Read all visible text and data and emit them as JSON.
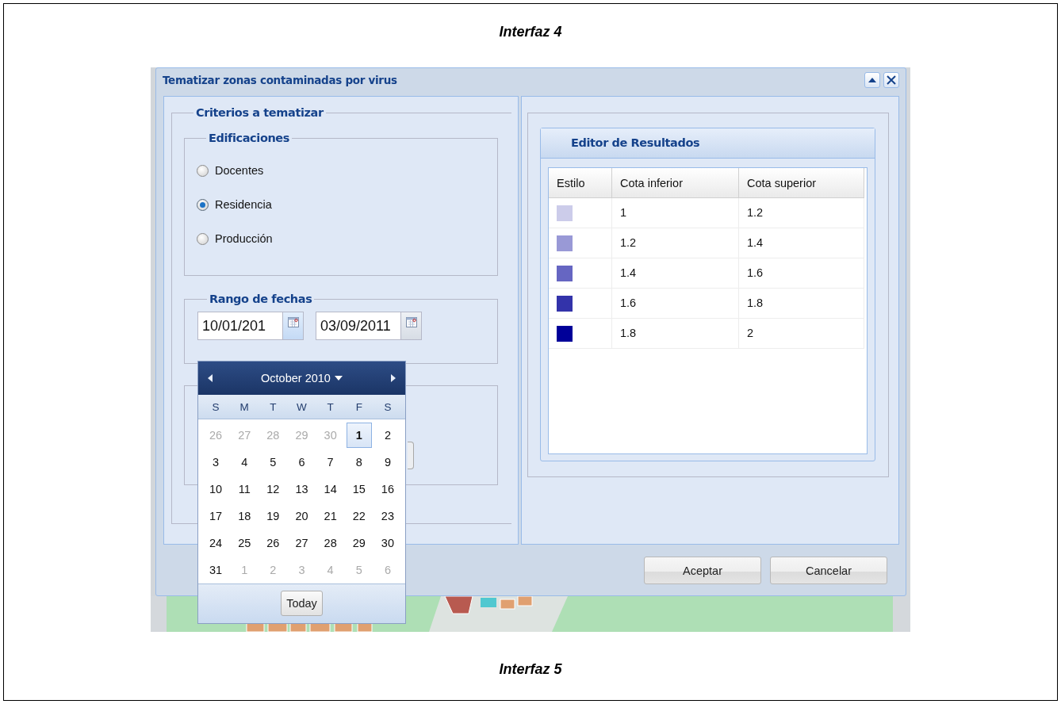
{
  "document": {
    "caption_top": "Interfaz 4",
    "caption_bottom": "Interfaz 5"
  },
  "window": {
    "title": "Tematizar zonas contaminadas por virus"
  },
  "criteria": {
    "legend": "Criterios a tematizar",
    "buildings": {
      "legend": "Edificaciones",
      "options": [
        {
          "label": "Docentes",
          "selected": false
        },
        {
          "label": "Residencia",
          "selected": true
        },
        {
          "label": "Producción",
          "selected": false
        }
      ]
    },
    "date_range": {
      "legend": "Rango de fechas",
      "from": "10/01/201",
      "to": "03/09/2011"
    }
  },
  "calendar": {
    "month_label": "October 2010",
    "weekdays": [
      "S",
      "M",
      "T",
      "W",
      "T",
      "F",
      "S"
    ],
    "weeks": [
      [
        {
          "day": "26",
          "muted": true,
          "selected": false
        },
        {
          "day": "27",
          "muted": true,
          "selected": false
        },
        {
          "day": "28",
          "muted": true,
          "selected": false
        },
        {
          "day": "29",
          "muted": true,
          "selected": false
        },
        {
          "day": "30",
          "muted": true,
          "selected": false
        },
        {
          "day": "1",
          "muted": false,
          "selected": true
        },
        {
          "day": "2",
          "muted": false,
          "selected": false
        }
      ],
      [
        {
          "day": "3",
          "muted": false,
          "selected": false
        },
        {
          "day": "4",
          "muted": false,
          "selected": false
        },
        {
          "day": "5",
          "muted": false,
          "selected": false
        },
        {
          "day": "6",
          "muted": false,
          "selected": false
        },
        {
          "day": "7",
          "muted": false,
          "selected": false
        },
        {
          "day": "8",
          "muted": false,
          "selected": false
        },
        {
          "day": "9",
          "muted": false,
          "selected": false
        }
      ],
      [
        {
          "day": "10",
          "muted": false,
          "selected": false
        },
        {
          "day": "11",
          "muted": false,
          "selected": false
        },
        {
          "day": "12",
          "muted": false,
          "selected": false
        },
        {
          "day": "13",
          "muted": false,
          "selected": false
        },
        {
          "day": "14",
          "muted": false,
          "selected": false
        },
        {
          "day": "15",
          "muted": false,
          "selected": false
        },
        {
          "day": "16",
          "muted": false,
          "selected": false
        }
      ],
      [
        {
          "day": "17",
          "muted": false,
          "selected": false
        },
        {
          "day": "18",
          "muted": false,
          "selected": false
        },
        {
          "day": "19",
          "muted": false,
          "selected": false
        },
        {
          "day": "20",
          "muted": false,
          "selected": false
        },
        {
          "day": "21",
          "muted": false,
          "selected": false
        },
        {
          "day": "22",
          "muted": false,
          "selected": false
        },
        {
          "day": "23",
          "muted": false,
          "selected": false
        }
      ],
      [
        {
          "day": "24",
          "muted": false,
          "selected": false
        },
        {
          "day": "25",
          "muted": false,
          "selected": false
        },
        {
          "day": "26",
          "muted": false,
          "selected": false
        },
        {
          "day": "27",
          "muted": false,
          "selected": false
        },
        {
          "day": "28",
          "muted": false,
          "selected": false
        },
        {
          "day": "29",
          "muted": false,
          "selected": false
        },
        {
          "day": "30",
          "muted": false,
          "selected": false
        }
      ],
      [
        {
          "day": "31",
          "muted": false,
          "selected": false
        },
        {
          "day": "1",
          "muted": true,
          "selected": false
        },
        {
          "day": "2",
          "muted": true,
          "selected": false
        },
        {
          "day": "3",
          "muted": true,
          "selected": false
        },
        {
          "day": "4",
          "muted": true,
          "selected": false
        },
        {
          "day": "5",
          "muted": true,
          "selected": false
        },
        {
          "day": "6",
          "muted": true,
          "selected": false
        }
      ]
    ],
    "today_button": "Today"
  },
  "results": {
    "title": "Editor de Resultados",
    "columns": [
      "Estilo",
      "Cota inferior",
      "Cota superior"
    ],
    "rows": [
      {
        "color": "#ccccea",
        "lower": "1",
        "upper": "1.2"
      },
      {
        "color": "#9999d6",
        "lower": "1.2",
        "upper": "1.4"
      },
      {
        "color": "#6666c2",
        "lower": "1.4",
        "upper": "1.6"
      },
      {
        "color": "#3333aa",
        "lower": "1.6",
        "upper": "1.8"
      },
      {
        "color": "#000099",
        "lower": "1.8",
        "upper": "2"
      }
    ]
  },
  "buttons": [
    "Aceptar",
    "Cancelar"
  ]
}
